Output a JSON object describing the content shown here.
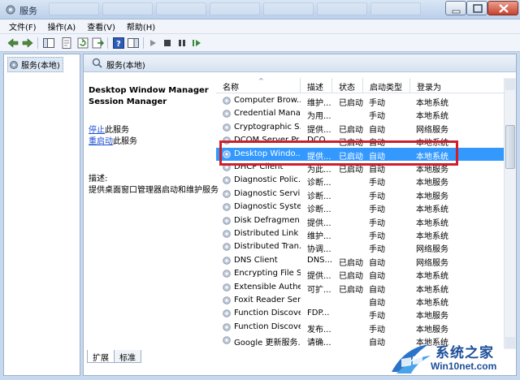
{
  "window": {
    "title": "服务"
  },
  "menu": [
    "文件(F)",
    "操作(A)",
    "查看(V)",
    "帮助(H)"
  ],
  "tree": {
    "node_label": "服务(本地)"
  },
  "panel": {
    "header_title": "服务(本地)",
    "selected_service_title": "Desktop Window Manager Session Manager",
    "stop_link": "停止",
    "stop_suffix": "此服务",
    "restart_link": "重启动",
    "restart_suffix": "此服务",
    "desc_label": "描述:",
    "desc_text": "提供桌面窗口管理器启动和维护服务"
  },
  "grid": {
    "columns": [
      "名称",
      "描述",
      "状态",
      "启动类型",
      "登录为"
    ],
    "rows": [
      {
        "name": "Computer Brow...",
        "desc": "维护...",
        "status": "已启动",
        "start": "手动",
        "logon": "本地系统"
      },
      {
        "name": "Credential Mana...",
        "desc": "为用...",
        "status": "",
        "start": "手动",
        "logon": "本地系统"
      },
      {
        "name": "Cryptographic S...",
        "desc": "提供...",
        "status": "已启动",
        "start": "自动",
        "logon": "网络服务"
      },
      {
        "name": "DCOM Server Pr...",
        "desc": "DCO...",
        "status": "已启动",
        "start": "自动",
        "logon": "本地系统"
      },
      {
        "name": "Desktop Windo...",
        "desc": "提供...",
        "status": "已启动",
        "start": "自动",
        "logon": "本地系统"
      },
      {
        "name": "DHCP Client",
        "desc": "为此...",
        "status": "已启动",
        "start": "自动",
        "logon": "本地服务"
      },
      {
        "name": "Diagnostic Polic...",
        "desc": "诊断...",
        "status": "",
        "start": "手动",
        "logon": "本地服务"
      },
      {
        "name": "Diagnostic Servi...",
        "desc": "诊断...",
        "status": "",
        "start": "手动",
        "logon": "本地服务"
      },
      {
        "name": "Diagnostic Syste...",
        "desc": "诊断...",
        "status": "",
        "start": "手动",
        "logon": "本地系统"
      },
      {
        "name": "Disk Defragmen...",
        "desc": "提供...",
        "status": "",
        "start": "手动",
        "logon": "本地系统"
      },
      {
        "name": "Distributed Link ...",
        "desc": "维护...",
        "status": "",
        "start": "手动",
        "logon": "本地系统"
      },
      {
        "name": "Distributed Tran...",
        "desc": "协调...",
        "status": "",
        "start": "手动",
        "logon": "网络服务"
      },
      {
        "name": "DNS Client",
        "desc": "DNS...",
        "status": "已启动",
        "start": "自动",
        "logon": "网络服务"
      },
      {
        "name": "Encrypting File S...",
        "desc": "提供...",
        "status": "已启动",
        "start": "自动",
        "logon": "本地系统"
      },
      {
        "name": "Extensible Authe...",
        "desc": "可扩...",
        "status": "已启动",
        "start": "自动",
        "logon": "本地系统"
      },
      {
        "name": "Foxit Reader Ser...",
        "desc": "",
        "status": "",
        "start": "自动",
        "logon": "本地系统"
      },
      {
        "name": "Function Discove...",
        "desc": "FDP...",
        "status": "",
        "start": "手动",
        "logon": "本地服务"
      },
      {
        "name": "Function Discove...",
        "desc": "发布...",
        "status": "",
        "start": "手动",
        "logon": "本地服务"
      },
      {
        "name": "Google 更新服务...",
        "desc": "请确...",
        "status": "",
        "start": "自动",
        "logon": "本地系统"
      }
    ],
    "selected_index": 4
  },
  "tabs": [
    "扩展",
    "标准"
  ],
  "watermark": {
    "cn": "系统之家",
    "url": "Win10net.com"
  },
  "colors": {
    "selection": "#3399ff",
    "highlight_border": "#d01f2a",
    "link": "#1b4fd0"
  }
}
